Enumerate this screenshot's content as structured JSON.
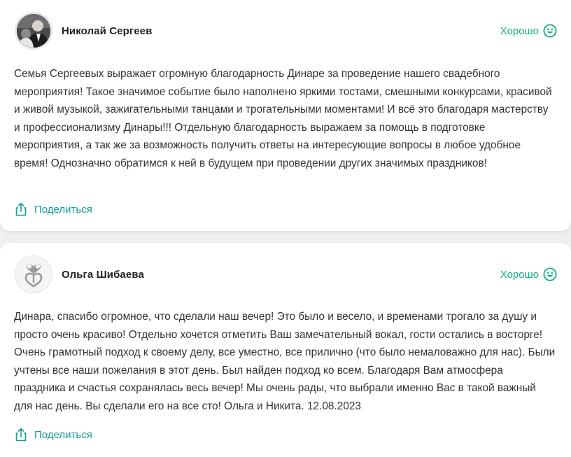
{
  "reviews": [
    {
      "author": "Николай Сергеев",
      "rating_label": "Хорошо",
      "text": "Семья Сергеевых выражает огромную благодарность Динаре за проведение нашего свадебного мероприятия! Такое значимое событие было наполнено яркими тостами, смешными конкурсами, красивой и живой музыкой, зажигательными танцами и трогательными моментами! И всё это благодаря мастерству и профессионализму Динары!!! Отдельную благодарность выражаем за помощь в подготовке мероприятия, а так же за возможность получить ответы на интересующие вопросы в любое удобное время! Однозначно обратимся к ней в будущем при проведении других значимых праздников!",
      "share_label": "Поделиться"
    },
    {
      "author": "Ольга Шибаева",
      "rating_label": "Хорошо",
      "text": "Динара, спасибо огромное, что сделали наш вечер! Это было и весело, и временами трогало за душу и просто очень красиво! Отдельно хочется отметить Ваш замечательный вокал, гости остались в восторге! Очень грамотный подход к своему делу, все уместно, все прилично (что было немаловажно для нас). Были учтены все наши пожелания в этот день. Был найден подход ко всем. Благодаря Вам атмосфера праздника и счастья сохранялась весь вечер! Мы очень рады, что выбрали именно Вас в такой важный для нас день. Вы сделали его на все сто! Ольга и Никита. 12.08.2023",
      "share_label": "Поделиться"
    }
  ],
  "icons": {
    "rating": "smile-face-icon",
    "share": "share-icon",
    "avatar_1": "user-photo-avatar",
    "avatar_2": "two-hearts-logo-avatar"
  },
  "colors": {
    "accent_green": "#14b07a",
    "link_teal": "#139e92",
    "text": "#333333",
    "background": "#efeff1"
  }
}
